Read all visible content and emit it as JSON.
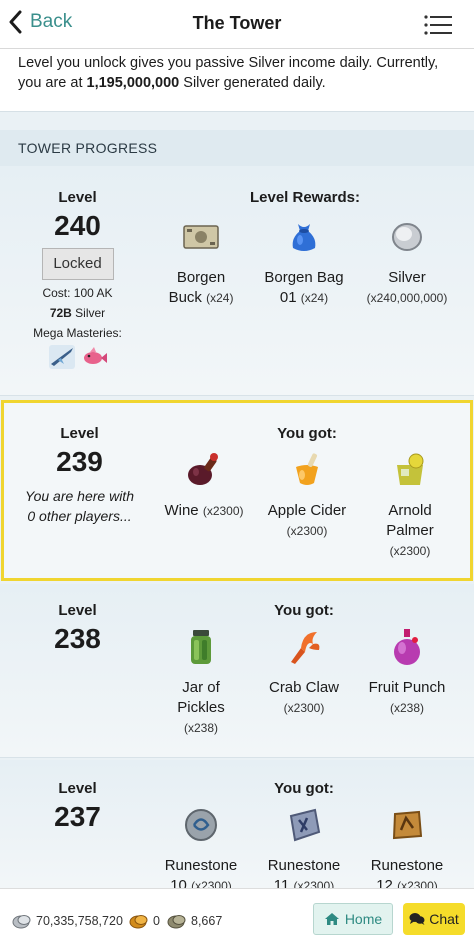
{
  "header": {
    "back_label": "Back",
    "title": "The Tower"
  },
  "intro": {
    "line1": "Level you unlock gives you passive Silver income daily. Currently,",
    "line2_pre": "you are at ",
    "line2_value": "1,195,000,000",
    "line2_post": " Silver generated daily."
  },
  "section": {
    "title": "TOWER PROGRESS"
  },
  "levels": [
    {
      "level_label": "Level",
      "level": "240",
      "locked_label": "Locked",
      "cost": "Cost: 100 AK",
      "silver_req": "72B",
      "silver_req_suffix": " Silver",
      "mega_label": "Mega Masteries:",
      "rewards_title": "Level Rewards:",
      "rewards": [
        {
          "name1": "Borgen",
          "name2": "Buck",
          "qty": "(x24)",
          "icon": "banknote-icon"
        },
        {
          "name1": "Borgen Bag",
          "name2": "01",
          "qty": "(x24)",
          "icon": "bag-icon"
        },
        {
          "name1": "Silver",
          "name2": "",
          "qty": "(x240,000,000)",
          "icon": "silver-coin-icon"
        }
      ]
    },
    {
      "level_label": "Level",
      "level": "239",
      "status1": "You are here with",
      "status2": "0 other players...",
      "rewards_title": "You got:",
      "rewards": [
        {
          "name1": "Wine",
          "qty": "(x2300)",
          "icon": "wine-icon"
        },
        {
          "name1": "Apple Cider",
          "qty": "(x2300)",
          "icon": "cider-icon"
        },
        {
          "name1": "Arnold",
          "name2": "Palmer",
          "qty": "(x2300)",
          "icon": "arnold-palmer-icon"
        }
      ]
    },
    {
      "level_label": "Level",
      "level": "238",
      "rewards_title": "You got:",
      "rewards": [
        {
          "name1": "Jar of",
          "name2": "Pickles",
          "qty": "(x238)",
          "icon": "pickle-jar-icon"
        },
        {
          "name1": "Crab Claw",
          "qty": "(x2300)",
          "icon": "crab-claw-icon"
        },
        {
          "name1": "Fruit Punch",
          "qty": "(x238)",
          "icon": "fruit-punch-icon"
        }
      ]
    },
    {
      "level_label": "Level",
      "level": "237",
      "rewards_title": "You got:",
      "rewards": [
        {
          "name1": "Runestone",
          "name2": "10",
          "qty": "(x2300)",
          "icon": "runestone-icon"
        },
        {
          "name1": "Runestone",
          "name2": "11",
          "qty": "(x2300)",
          "icon": "runestone-icon"
        },
        {
          "name1": "Runestone",
          "name2": "12",
          "qty": "(x2300)",
          "icon": "runestone-icon"
        }
      ]
    }
  ],
  "footer": {
    "silver": "70,335,758,720",
    "gold": "0",
    "other": "8,667",
    "home_label": "Home",
    "chat_label": "Chat"
  }
}
